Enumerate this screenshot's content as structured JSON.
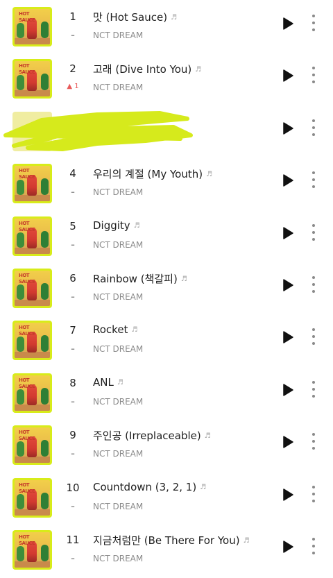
{
  "artist_name": "NCT DREAM",
  "tracks": [
    {
      "num": "1",
      "title": "맛 (Hot Sauce)",
      "rank": "–",
      "rank_dir": "none",
      "lyrics_icon": "lyrics-icon"
    },
    {
      "num": "2",
      "title": "고래 (Dive Into You)",
      "rank": "▲ 1",
      "rank_dir": "up",
      "lyrics_icon": "lyrics-icon"
    },
    {
      "num": "",
      "title": "",
      "rank": "",
      "rank_dir": "hidden",
      "redacted": true
    },
    {
      "num": "4",
      "title": "우리의 계절 (My Youth)",
      "rank": "–",
      "rank_dir": "none",
      "lyrics_icon": "lyrics-icon"
    },
    {
      "num": "5",
      "title": "Diggity",
      "rank": "–",
      "rank_dir": "none",
      "lyrics_icon": "lyrics-icon"
    },
    {
      "num": "6",
      "title": "Rainbow (책갈피)",
      "rank": "–",
      "rank_dir": "none",
      "lyrics_icon": "lyrics-icon"
    },
    {
      "num": "7",
      "title": "Rocket",
      "rank": "–",
      "rank_dir": "none",
      "lyrics_icon": "lyrics-icon"
    },
    {
      "num": "8",
      "title": "ANL",
      "rank": "–",
      "rank_dir": "none",
      "lyrics_icon": "lyrics-icon"
    },
    {
      "num": "9",
      "title": "주인공 (Irreplaceable)",
      "rank": "–",
      "rank_dir": "none",
      "lyrics_icon": "lyrics-icon"
    },
    {
      "num": "10",
      "title": "Countdown (3, 2, 1)",
      "rank": "–",
      "rank_dir": "none",
      "lyrics_icon": "lyrics-icon"
    },
    {
      "num": "11",
      "title": "지금처럼만 (Be There For You)",
      "rank": "–",
      "rank_dir": "none",
      "lyrics_icon": "lyrics-icon"
    }
  ],
  "album_art_label": "HOT SAUCE",
  "colors": {
    "art_border": "#d8ec1a",
    "redact": "#d6ea1c",
    "rank_up": "#e85b5b"
  },
  "icons": {
    "play": "play-icon",
    "more": "more-vert-icon",
    "lyrics": "lyrics-icon"
  }
}
